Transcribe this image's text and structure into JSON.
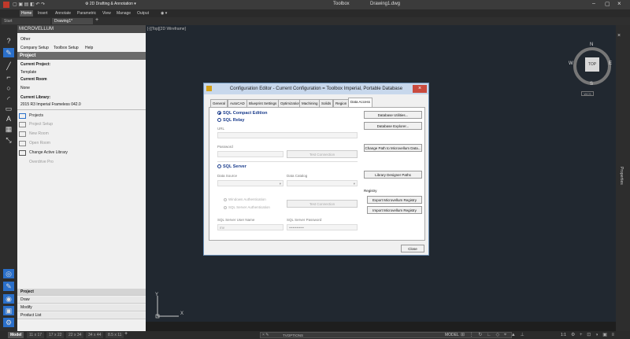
{
  "titlebar": {
    "workspace": "2D Drafting & Annotation",
    "app_title": "Toolbox",
    "file_title": "Drawing1.dwg"
  },
  "ribbon_tabs": [
    "Home",
    "Insert",
    "Annotate",
    "Parametric",
    "View",
    "Manage",
    "Output"
  ],
  "doc_tabs": [
    "Start",
    "Drawing1*"
  ],
  "panel": {
    "title": "MICROVELLUM",
    "other_label": "Other",
    "menu": [
      "Company Setup",
      "Toolbox Setup",
      "Help"
    ],
    "section_title": "Project",
    "current_project_label": "Current Project:",
    "current_project_value": "Template",
    "current_room_label": "Current Room",
    "current_room_value": "None",
    "current_library_label": "Current Library:",
    "current_library_value": "2015 R3 Imperial Frameless 042.0",
    "items": [
      {
        "label": "Projects",
        "enabled": true
      },
      {
        "label": "Project Setup",
        "enabled": false
      },
      {
        "label": "New Room",
        "enabled": false
      },
      {
        "label": "Open Room",
        "enabled": false
      },
      {
        "label": "Change Active Library",
        "enabled": true
      },
      {
        "label": "Overdrive Pro",
        "enabled": false
      }
    ],
    "bottom_items": [
      "Project",
      "Draw",
      "Modify",
      "Product List"
    ]
  },
  "viewport": {
    "label": "[-][Top][2D Wireframe]",
    "cube": {
      "top": "TOP",
      "n": "N",
      "s": "S",
      "e": "E",
      "w": "W",
      "wcs": "WCS"
    },
    "ucs_y": "Y",
    "ucs_x": "X"
  },
  "right_strip": {
    "label": "Properties"
  },
  "dialog": {
    "title": "Configuration Editor - Current Configuration = Toolbox Imperial, Portable Database",
    "tabs": [
      "General",
      "AutoCAD",
      "Blueprint Settings",
      "Optimization",
      "Machining",
      "Solids",
      "Region",
      "Data Access"
    ],
    "active_tab": "Data Access",
    "sql_compact": "SQL Compact Edition",
    "sql_relay": "SQL Relay",
    "url_label": "URL",
    "password_label": "Password",
    "test_connection": "Test Connection",
    "sql_server": "SQL Server",
    "data_source_label": "Data Source",
    "data_catalog_label": "Data Catalog",
    "windows_auth": "Windows Authentication",
    "sql_auth": "SQL Server Authentication",
    "sql_user_label": "SQL Server User Name",
    "sql_user_value": "mv",
    "sql_password_label": "SQL Server Password",
    "sql_password_value": "••••••••••••",
    "right_buttons": {
      "db_utilities": "Database Utilities...",
      "db_explorer": "Database Explorer...",
      "change_path": "Change Path to Microvellum Data...",
      "library_paths": "Library Designer Paths",
      "registry_label": "Registry",
      "export_registry": "Export Microvellum Registry",
      "import_registry": "Import Microvellum Registry"
    },
    "close": "Close"
  },
  "statusbar": {
    "model_tab": "Model",
    "layouts": [
      "11 x 17",
      "17 x 22",
      "22 x 34",
      "34 x 44",
      "8.5 x 11"
    ],
    "command_placeholder": "TVOPTIONS",
    "model_label": "MODEL",
    "scale": "1:1"
  }
}
